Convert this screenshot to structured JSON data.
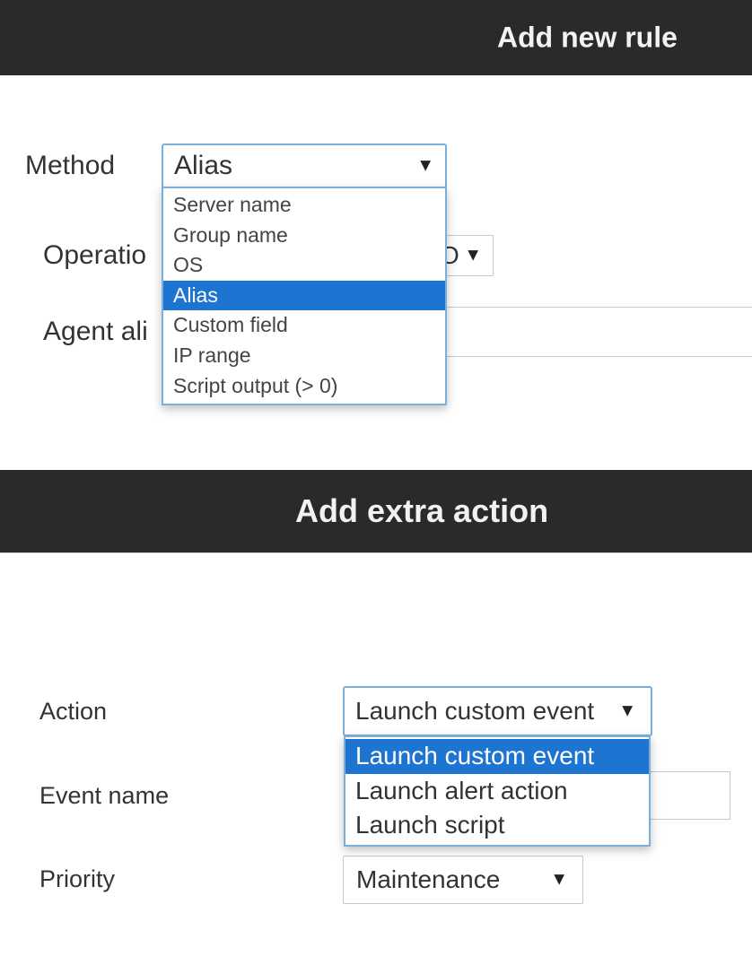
{
  "rule_panel": {
    "title": "Add new rule",
    "method_label": "Method",
    "method_value": "Alias",
    "method_options": [
      "Server name",
      "Group name",
      "OS",
      "Alias",
      "Custom field",
      "IP range",
      "Script output (> 0)"
    ],
    "method_selected_index": 3,
    "operation_label": "Operatio",
    "operation_value": "O",
    "agent_alias_label": "Agent ali"
  },
  "action_panel": {
    "title": "Add extra action",
    "action_label": "Action",
    "action_value": "Launch custom event",
    "action_options": [
      "Launch custom event",
      "Launch alert action",
      "Launch script"
    ],
    "action_selected_index": 0,
    "event_name_label": "Event name",
    "priority_label": "Priority",
    "priority_value": "Maintenance"
  },
  "icons": {
    "dropdown_arrow": "caret-down-icon"
  },
  "colors": {
    "header_bg": "#2a2a2a",
    "focus_border": "#7aaedc",
    "selected_option": "#1d74d1"
  }
}
